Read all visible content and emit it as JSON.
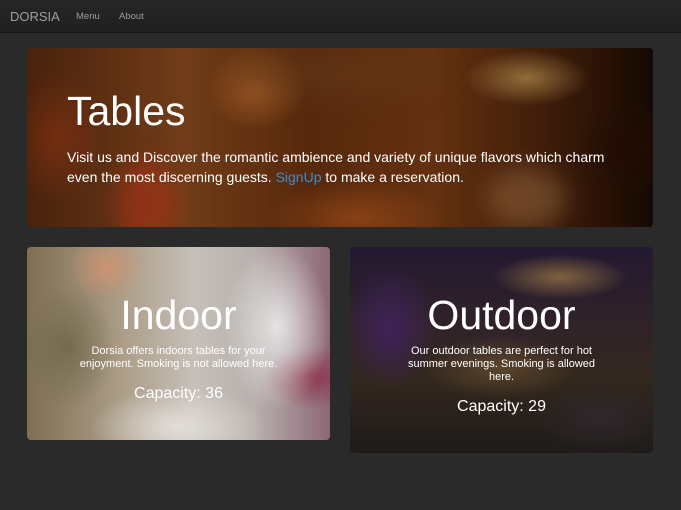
{
  "navbar": {
    "brand": "DORSIA",
    "links": [
      {
        "label": "Menu"
      },
      {
        "label": "About"
      }
    ]
  },
  "hero": {
    "title": "Tables",
    "text_before": "Visit us and Discover the romantic ambience and variety of unique flavors which charm even the most discerning guests. ",
    "signup_link": "SignUp",
    "text_after": " to make a reservation."
  },
  "cards": [
    {
      "title": "Indoor",
      "description": "Dorsia offers indoors tables for your enjoyment. Smoking is not allowed here.",
      "capacity": "Capacity: 36"
    },
    {
      "title": "Outdoor",
      "description": "Our outdoor tables are perfect for hot summer evenings. Smoking is allowed here.",
      "capacity": "Capacity: 29"
    }
  ],
  "colors": {
    "page_background": "#2a2a2a",
    "navbar_background": "#222222",
    "nav_text": "#9d9d9d",
    "link_accent": "#428bca",
    "text": "#ffffff"
  }
}
